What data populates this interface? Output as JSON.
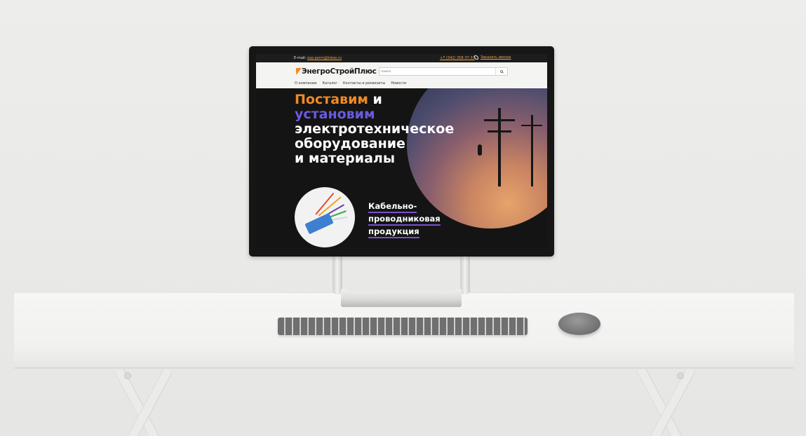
{
  "site": {
    "topbar": {
      "email_label": "E-mail:",
      "email": "esp-perm@inbox.ru",
      "phone": "+7 (342) 258-37-33",
      "callback": "Заказать звонок"
    },
    "logo": "ЭнегроСтройПлюс",
    "search": {
      "placeholder": "Поиск"
    },
    "nav": [
      "О компании",
      "Каталог",
      "Контакты и реквизиты",
      "Новости"
    ],
    "hero": {
      "line1_accent": "Поставим",
      "line1_rest": "и",
      "line2": "установим",
      "line3": "электротехническое",
      "line4": "оборудование",
      "line5": "и материалы"
    },
    "product": {
      "line1": "Кабельно-",
      "line2": "проводниковая",
      "line3": "продукция"
    }
  },
  "colors": {
    "accent_orange": "#f08a24",
    "accent_purple": "#6a5ae0",
    "underline": "#7a4fd0"
  },
  "icons": [
    "phone-icon",
    "bolt-icon",
    "search-icon"
  ]
}
